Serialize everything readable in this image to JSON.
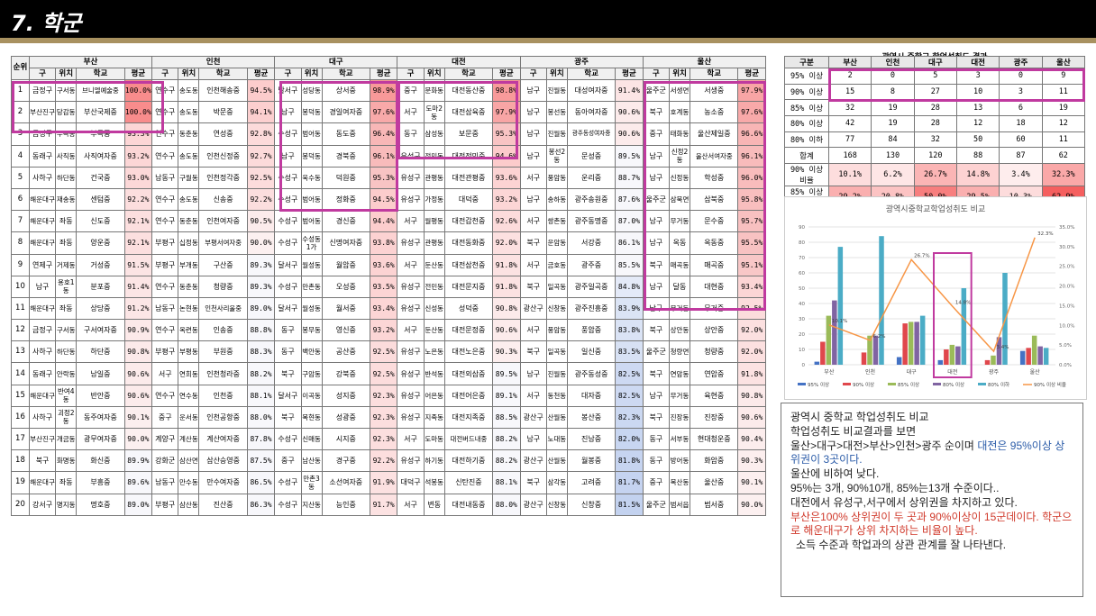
{
  "title": "7. 학군",
  "main_table": {
    "rank_header": "순위",
    "sub_headers": [
      "구",
      "위치",
      "학교",
      "평균"
    ],
    "cities": [
      "부산",
      "인천",
      "대구",
      "대전",
      "광주",
      "울산"
    ],
    "rows": [
      {
        "rank": "1",
        "cells": [
          [
            "금정구",
            "구서동",
            "브니엘예술중",
            "100.0%"
          ],
          [
            "연수구",
            "송도동",
            "인천해송중",
            "94.5%"
          ],
          [
            "달서구",
            "성당동",
            "상서중",
            "98.9%"
          ],
          [
            "중구",
            "문화동",
            "대전동산중",
            "98.8%"
          ],
          [
            "남구",
            "진월동",
            "대성여자중",
            "91.4%"
          ],
          [
            "울주군",
            "서생면",
            "서생중",
            "97.9%"
          ]
        ]
      },
      {
        "rank": "2",
        "cells": [
          [
            "부산진구",
            "당감동",
            "부산국제중",
            "100.0%"
          ],
          [
            "연수구",
            "송도동",
            "박문중",
            "94.1%"
          ],
          [
            "남구",
            "봉덕동",
            "경일여자중",
            "97.6%"
          ],
          [
            "서구",
            "도마2동",
            "대전삼육중",
            "97.9%"
          ],
          [
            "남구",
            "봉선동",
            "동아여자중",
            "90.6%"
          ],
          [
            "북구",
            "호계동",
            "농소중",
            "97.6%"
          ]
        ]
      },
      {
        "rank": "3",
        "cells": [
          [
            "금정구",
            "부곡동",
            "부곡중",
            "93.3%"
          ],
          [
            "연수구",
            "동춘동",
            "연성중",
            "92.8%"
          ],
          [
            "수성구",
            "범어동",
            "동도중",
            "96.4%"
          ],
          [
            "동구",
            "삼성동",
            "보문중",
            "95.3%"
          ],
          [
            "남구",
            "진월동",
            "광주동성여자중",
            "90.6%"
          ],
          [
            "중구",
            "태화동",
            "울산제일중",
            "96.6%"
          ]
        ]
      },
      {
        "rank": "4",
        "cells": [
          [
            "동래구",
            "사직동",
            "사직여자중",
            "93.2%"
          ],
          [
            "연수구",
            "송도동",
            "인천신정중",
            "92.7%"
          ],
          [
            "남구",
            "봉덕동",
            "경북중",
            "96.1%"
          ],
          [
            "유성구",
            "전민동",
            "대전전민중",
            "94.6%"
          ],
          [
            "남구",
            "봉선2동",
            "문성중",
            "89.5%"
          ],
          [
            "남구",
            "신정2동",
            "울산서여자중",
            "96.1%"
          ]
        ]
      },
      {
        "rank": "5",
        "cells": [
          [
            "사하구",
            "하단동",
            "건국중",
            "93.0%"
          ],
          [
            "남동구",
            "구월동",
            "인천정각중",
            "92.5%"
          ],
          [
            "수성구",
            "욱수동",
            "덕원중",
            "95.3%"
          ],
          [
            "유성구",
            "관평동",
            "대전관평중",
            "93.6%"
          ],
          [
            "서구",
            "풍암동",
            "운리중",
            "88.7%"
          ],
          [
            "남구",
            "신정동",
            "학성중",
            "96.0%"
          ]
        ]
      },
      {
        "rank": "6",
        "cells": [
          [
            "해운대구",
            "재송동",
            "센텀중",
            "92.2%"
          ],
          [
            "연수구",
            "송도동",
            "신송중",
            "92.2%"
          ],
          [
            "수성구",
            "범어동",
            "정화중",
            "94.5%"
          ],
          [
            "유성구",
            "가정동",
            "대덕중",
            "93.2%"
          ],
          [
            "남구",
            "송하동",
            "광주송원중",
            "87.6%"
          ],
          [
            "울주군",
            "삼북면",
            "삼북중",
            "95.8%"
          ]
        ]
      },
      {
        "rank": "7",
        "cells": [
          [
            "해운대구",
            "좌동",
            "신도중",
            "92.1%"
          ],
          [
            "연수구",
            "동춘동",
            "인천여자중",
            "90.5%"
          ],
          [
            "수성구",
            "범어동",
            "경신중",
            "94.4%"
          ],
          [
            "서구",
            "월평동",
            "대전갑천중",
            "92.6%"
          ],
          [
            "서구",
            "쌍촌동",
            "광주동명중",
            "87.0%"
          ],
          [
            "남구",
            "무거동",
            "문수중",
            "95.7%"
          ]
        ]
      },
      {
        "rank": "8",
        "cells": [
          [
            "해운대구",
            "좌동",
            "양운중",
            "92.1%"
          ],
          [
            "부평구",
            "십정동",
            "부평서여자중",
            "90.0%"
          ],
          [
            "수성구",
            "수성동1가",
            "신명여자중",
            "93.8%"
          ],
          [
            "유성구",
            "관평동",
            "대전동화중",
            "92.0%"
          ],
          [
            "북구",
            "운암동",
            "서강중",
            "86.1%"
          ],
          [
            "남구",
            "옥동",
            "옥동중",
            "95.5%"
          ]
        ]
      },
      {
        "rank": "9",
        "cells": [
          [
            "연제구",
            "거제동",
            "거성중",
            "91.5%"
          ],
          [
            "부평구",
            "부개동",
            "구산중",
            "89.3%"
          ],
          [
            "달서구",
            "월성동",
            "월암중",
            "93.6%"
          ],
          [
            "서구",
            "둔산동",
            "대전삼천중",
            "91.8%"
          ],
          [
            "서구",
            "금호동",
            "광주중",
            "85.5%"
          ],
          [
            "북구",
            "매곡동",
            "매곡중",
            "95.1%"
          ]
        ]
      },
      {
        "rank": "10",
        "cells": [
          [
            "남구",
            "용호1동",
            "분포중",
            "91.4%"
          ],
          [
            "연수구",
            "동춘동",
            "청량중",
            "89.3%"
          ],
          [
            "수성구",
            "만촌동",
            "오성중",
            "93.5%"
          ],
          [
            "유성구",
            "전민동",
            "대전문지중",
            "91.8%"
          ],
          [
            "북구",
            "일곡동",
            "광주일곡중",
            "84.8%"
          ],
          [
            "남구",
            "달동",
            "대현중",
            "93.4%"
          ]
        ]
      },
      {
        "rank": "11",
        "cells": [
          [
            "해운대구",
            "좌동",
            "상당중",
            "91.2%"
          ],
          [
            "남동구",
            "논현동",
            "인천사리울중",
            "89.0%"
          ],
          [
            "달서구",
            "월성동",
            "월서중",
            "93.4%"
          ],
          [
            "유성구",
            "신성동",
            "성덕중",
            "90.8%"
          ],
          [
            "광산구",
            "신창동",
            "광주진흥중",
            "83.9%"
          ],
          [
            "남구",
            "무거동",
            "무거중",
            "92.5%"
          ]
        ]
      },
      {
        "rank": "12",
        "cells": [
          [
            "금정구",
            "구서동",
            "구서여자중",
            "90.9%"
          ],
          [
            "연수구",
            "옥련동",
            "인송중",
            "88.8%"
          ],
          [
            "동구",
            "봉무동",
            "영신중",
            "93.2%"
          ],
          [
            "서구",
            "둔산동",
            "대전문정중",
            "90.6%"
          ],
          [
            "서구",
            "풍암동",
            "풍암중",
            "83.8%"
          ],
          [
            "북구",
            "상안동",
            "상안중",
            "92.0%"
          ]
        ]
      },
      {
        "rank": "13",
        "cells": [
          [
            "사하구",
            "하단동",
            "하단중",
            "90.8%"
          ],
          [
            "부평구",
            "부평동",
            "부원중",
            "88.3%"
          ],
          [
            "동구",
            "백안동",
            "공산중",
            "92.5%"
          ],
          [
            "유성구",
            "노은동",
            "대전노은중",
            "90.3%"
          ],
          [
            "북구",
            "일곡동",
            "일신중",
            "83.5%"
          ],
          [
            "울주군",
            "청량면",
            "청량중",
            "92.0%"
          ]
        ]
      },
      {
        "rank": "14",
        "cells": [
          [
            "동래구",
            "안락동",
            "남일중",
            "90.6%"
          ],
          [
            "서구",
            "연희동",
            "인천청라중",
            "88.2%"
          ],
          [
            "북구",
            "구암동",
            "강북중",
            "92.5%"
          ],
          [
            "유성구",
            "반석동",
            "대전외삼중",
            "89.5%"
          ],
          [
            "남구",
            "진월동",
            "광주동성중",
            "82.5%"
          ],
          [
            "북구",
            "연암동",
            "연암중",
            "91.8%"
          ]
        ]
      },
      {
        "rank": "15",
        "cells": [
          [
            "해운대구",
            "반여4동",
            "반안중",
            "90.6%"
          ],
          [
            "연수구",
            "연수동",
            "인천중",
            "88.1%"
          ],
          [
            "달서구",
            "이곡동",
            "성지중",
            "92.3%"
          ],
          [
            "유성구",
            "어은동",
            "대전어은중",
            "89.1%"
          ],
          [
            "서구",
            "동천동",
            "대자중",
            "82.5%"
          ],
          [
            "남구",
            "무거동",
            "육현중",
            "90.8%"
          ]
        ]
      },
      {
        "rank": "16",
        "cells": [
          [
            "사하구",
            "괴정2동",
            "동주여자중",
            "90.1%"
          ],
          [
            "중구",
            "운서동",
            "인천공항중",
            "88.0%"
          ],
          [
            "북구",
            "복현동",
            "성광중",
            "92.3%"
          ],
          [
            "유성구",
            "지족동",
            "대전지족중",
            "88.5%"
          ],
          [
            "광산구",
            "산월동",
            "봉산중",
            "82.3%"
          ],
          [
            "북구",
            "진장동",
            "진장중",
            "90.6%"
          ]
        ]
      },
      {
        "rank": "17",
        "cells": [
          [
            "부산진구",
            "개금동",
            "광무여자중",
            "90.0%"
          ],
          [
            "계양구",
            "계산동",
            "계산여자중",
            "87.8%"
          ],
          [
            "수성구",
            "신매동",
            "시지중",
            "92.3%"
          ],
          [
            "서구",
            "도마동",
            "대전버드내중",
            "88.2%"
          ],
          [
            "남구",
            "노대동",
            "진남중",
            "82.0%"
          ],
          [
            "동구",
            "서부동",
            "현대청운중",
            "90.4%"
          ]
        ]
      },
      {
        "rank": "18",
        "cells": [
          [
            "북구",
            "화명동",
            "화신중",
            "89.9%"
          ],
          [
            "강화군",
            "삼산면",
            "삼산승영중",
            "87.5%"
          ],
          [
            "중구",
            "남산동",
            "경구중",
            "92.2%"
          ],
          [
            "유성구",
            "하기동",
            "대전하기중",
            "88.2%"
          ],
          [
            "광산구",
            "산월동",
            "월봉중",
            "81.8%"
          ],
          [
            "동구",
            "방어동",
            "화암중",
            "90.3%"
          ]
        ]
      },
      {
        "rank": "19",
        "cells": [
          [
            "해운대구",
            "좌동",
            "부흥중",
            "89.6%"
          ],
          [
            "남동구",
            "만수동",
            "만수여자중",
            "86.5%"
          ],
          [
            "수성구",
            "만촌3동",
            "소선여자중",
            "91.9%"
          ],
          [
            "대덕구",
            "석봉동",
            "신탄진중",
            "88.1%"
          ],
          [
            "북구",
            "삼각동",
            "고려중",
            "81.7%"
          ],
          [
            "중구",
            "복산동",
            "울산중",
            "90.1%"
          ]
        ]
      },
      {
        "rank": "20",
        "cells": [
          [
            "강서구",
            "명지동",
            "명호중",
            "89.0%"
          ],
          [
            "부평구",
            "삼산동",
            "진산중",
            "86.3%"
          ],
          [
            "수성구",
            "지산동",
            "능인중",
            "91.7%"
          ],
          [
            "서구",
            "변동",
            "대전내동중",
            "88.0%"
          ],
          [
            "광산구",
            "신창동",
            "신창중",
            "81.5%"
          ],
          [
            "울주군",
            "범서읍",
            "범서중",
            "90.0%"
          ]
        ]
      }
    ]
  },
  "summary": {
    "title": "광역시 중학교 학업성취도 결과",
    "headers": [
      "구분",
      "부산",
      "인천",
      "대구",
      "대전",
      "광주",
      "울산"
    ],
    "rows": [
      {
        "label": "95% 이상",
        "values": [
          "2",
          "0",
          "5",
          "3",
          "0",
          "9"
        ]
      },
      {
        "label": "90% 이상",
        "values": [
          "15",
          "8",
          "27",
          "10",
          "3",
          "11"
        ]
      },
      {
        "label": "85% 이상",
        "values": [
          "32",
          "19",
          "28",
          "13",
          "6",
          "19"
        ]
      },
      {
        "label": "80% 이상",
        "values": [
          "42",
          "19",
          "28",
          "12",
          "18",
          "12"
        ]
      },
      {
        "label": "80% 이하",
        "values": [
          "77",
          "84",
          "32",
          "50",
          "60",
          "11"
        ]
      },
      {
        "label": "합계",
        "values": [
          "168",
          "130",
          "120",
          "88",
          "87",
          "62"
        ]
      },
      {
        "label": "90% 이상 비율",
        "values": [
          "10.1%",
          "6.2%",
          "26.7%",
          "14.8%",
          "3.4%",
          "32.3%"
        ]
      },
      {
        "label": "85% 이상 비율",
        "values": [
          "29.2%",
          "20.8%",
          "50.0%",
          "29.5%",
          "10.3%",
          "62.9%"
        ]
      }
    ]
  },
  "chart_data": {
    "type": "bar",
    "title": "광역시중학교학업성취도 비교",
    "categories": [
      "부산",
      "인천",
      "대구",
      "대전",
      "광주",
      "울산"
    ],
    "ylim": [
      0,
      90
    ],
    "y_ticks": [
      "0",
      "10",
      "20",
      "30",
      "40",
      "50",
      "60",
      "70",
      "80",
      "90"
    ],
    "y2lim": [
      0,
      35
    ],
    "y2_ticks": [
      "0.0%",
      "5.0%",
      "10.0%",
      "15.0%",
      "20.0%",
      "25.0%",
      "30.0%",
      "35.0%"
    ],
    "series": [
      {
        "name": "95% 이상",
        "values": [
          2,
          0,
          5,
          3,
          0,
          9
        ],
        "color": "#4472c4"
      },
      {
        "name": "90% 이상",
        "values": [
          15,
          8,
          27,
          10,
          3,
          11
        ],
        "color": "#e0474c"
      },
      {
        "name": "85% 이상",
        "values": [
          32,
          19,
          28,
          13,
          6,
          19
        ],
        "color": "#9bbb59"
      },
      {
        "name": "80% 이상",
        "values": [
          42,
          19,
          28,
          12,
          18,
          12
        ],
        "color": "#8064a2"
      },
      {
        "name": "80% 이하",
        "values": [
          77,
          84,
          32,
          50,
          60,
          11
        ],
        "color": "#4bacc6"
      }
    ],
    "line_series": {
      "name": "90% 이상 비율",
      "values": [
        10.1,
        6.2,
        26.7,
        14.8,
        3.4,
        32.3
      ],
      "labels": [
        "10.1%",
        "6.2%",
        "26.7%",
        "14.8%",
        "3.4%",
        "32.3%"
      ],
      "color": "#f79646"
    }
  },
  "note": {
    "line1": "광역시 중학교 학업성취도 비교",
    "line2": "학업성취도 비교결과를 보면",
    "line3a": "울산>대구>대전>부산>인천>광주 순이며 ",
    "line3b": "대전은 95%이상 상위권이 3곳이다.",
    "line4": "울산에 비하여 낮다.",
    "line5": "95%는 3개, 90%10개, 85%는13개 수준이다..",
    "line6": "대전에서 유성구,서구에서 상위권을 차지하고 있다.",
    "line7": "부산은100% 상위권이 두 곳과 90%이상이 15군데이다. 학군으로 해운대구가 상위 차지하는 비율이 높다.",
    "line8": "소득 수준과 학업과의 상관 관계를 잘 나타낸다."
  }
}
